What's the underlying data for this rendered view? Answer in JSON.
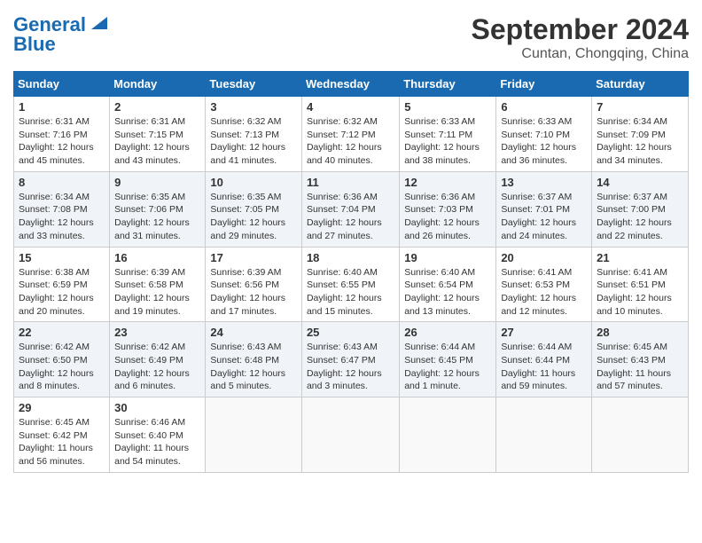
{
  "header": {
    "logo_line1": "General",
    "logo_line2": "Blue",
    "month": "September 2024",
    "location": "Cuntan, Chongqing, China"
  },
  "weekdays": [
    "Sunday",
    "Monday",
    "Tuesday",
    "Wednesday",
    "Thursday",
    "Friday",
    "Saturday"
  ],
  "weeks": [
    [
      {
        "day": "1",
        "info": "Sunrise: 6:31 AM\nSunset: 7:16 PM\nDaylight: 12 hours\nand 45 minutes."
      },
      {
        "day": "2",
        "info": "Sunrise: 6:31 AM\nSunset: 7:15 PM\nDaylight: 12 hours\nand 43 minutes."
      },
      {
        "day": "3",
        "info": "Sunrise: 6:32 AM\nSunset: 7:13 PM\nDaylight: 12 hours\nand 41 minutes."
      },
      {
        "day": "4",
        "info": "Sunrise: 6:32 AM\nSunset: 7:12 PM\nDaylight: 12 hours\nand 40 minutes."
      },
      {
        "day": "5",
        "info": "Sunrise: 6:33 AM\nSunset: 7:11 PM\nDaylight: 12 hours\nand 38 minutes."
      },
      {
        "day": "6",
        "info": "Sunrise: 6:33 AM\nSunset: 7:10 PM\nDaylight: 12 hours\nand 36 minutes."
      },
      {
        "day": "7",
        "info": "Sunrise: 6:34 AM\nSunset: 7:09 PM\nDaylight: 12 hours\nand 34 minutes."
      }
    ],
    [
      {
        "day": "8",
        "info": "Sunrise: 6:34 AM\nSunset: 7:08 PM\nDaylight: 12 hours\nand 33 minutes."
      },
      {
        "day": "9",
        "info": "Sunrise: 6:35 AM\nSunset: 7:06 PM\nDaylight: 12 hours\nand 31 minutes."
      },
      {
        "day": "10",
        "info": "Sunrise: 6:35 AM\nSunset: 7:05 PM\nDaylight: 12 hours\nand 29 minutes."
      },
      {
        "day": "11",
        "info": "Sunrise: 6:36 AM\nSunset: 7:04 PM\nDaylight: 12 hours\nand 27 minutes."
      },
      {
        "day": "12",
        "info": "Sunrise: 6:36 AM\nSunset: 7:03 PM\nDaylight: 12 hours\nand 26 minutes."
      },
      {
        "day": "13",
        "info": "Sunrise: 6:37 AM\nSunset: 7:01 PM\nDaylight: 12 hours\nand 24 minutes."
      },
      {
        "day": "14",
        "info": "Sunrise: 6:37 AM\nSunset: 7:00 PM\nDaylight: 12 hours\nand 22 minutes."
      }
    ],
    [
      {
        "day": "15",
        "info": "Sunrise: 6:38 AM\nSunset: 6:59 PM\nDaylight: 12 hours\nand 20 minutes."
      },
      {
        "day": "16",
        "info": "Sunrise: 6:39 AM\nSunset: 6:58 PM\nDaylight: 12 hours\nand 19 minutes."
      },
      {
        "day": "17",
        "info": "Sunrise: 6:39 AM\nSunset: 6:56 PM\nDaylight: 12 hours\nand 17 minutes."
      },
      {
        "day": "18",
        "info": "Sunrise: 6:40 AM\nSunset: 6:55 PM\nDaylight: 12 hours\nand 15 minutes."
      },
      {
        "day": "19",
        "info": "Sunrise: 6:40 AM\nSunset: 6:54 PM\nDaylight: 12 hours\nand 13 minutes."
      },
      {
        "day": "20",
        "info": "Sunrise: 6:41 AM\nSunset: 6:53 PM\nDaylight: 12 hours\nand 12 minutes."
      },
      {
        "day": "21",
        "info": "Sunrise: 6:41 AM\nSunset: 6:51 PM\nDaylight: 12 hours\nand 10 minutes."
      }
    ],
    [
      {
        "day": "22",
        "info": "Sunrise: 6:42 AM\nSunset: 6:50 PM\nDaylight: 12 hours\nand 8 minutes."
      },
      {
        "day": "23",
        "info": "Sunrise: 6:42 AM\nSunset: 6:49 PM\nDaylight: 12 hours\nand 6 minutes."
      },
      {
        "day": "24",
        "info": "Sunrise: 6:43 AM\nSunset: 6:48 PM\nDaylight: 12 hours\nand 5 minutes."
      },
      {
        "day": "25",
        "info": "Sunrise: 6:43 AM\nSunset: 6:47 PM\nDaylight: 12 hours\nand 3 minutes."
      },
      {
        "day": "26",
        "info": "Sunrise: 6:44 AM\nSunset: 6:45 PM\nDaylight: 12 hours\nand 1 minute."
      },
      {
        "day": "27",
        "info": "Sunrise: 6:44 AM\nSunset: 6:44 PM\nDaylight: 11 hours\nand 59 minutes."
      },
      {
        "day": "28",
        "info": "Sunrise: 6:45 AM\nSunset: 6:43 PM\nDaylight: 11 hours\nand 57 minutes."
      }
    ],
    [
      {
        "day": "29",
        "info": "Sunrise: 6:45 AM\nSunset: 6:42 PM\nDaylight: 11 hours\nand 56 minutes."
      },
      {
        "day": "30",
        "info": "Sunrise: 6:46 AM\nSunset: 6:40 PM\nDaylight: 11 hours\nand 54 minutes."
      },
      {
        "day": "",
        "info": ""
      },
      {
        "day": "",
        "info": ""
      },
      {
        "day": "",
        "info": ""
      },
      {
        "day": "",
        "info": ""
      },
      {
        "day": "",
        "info": ""
      }
    ]
  ]
}
